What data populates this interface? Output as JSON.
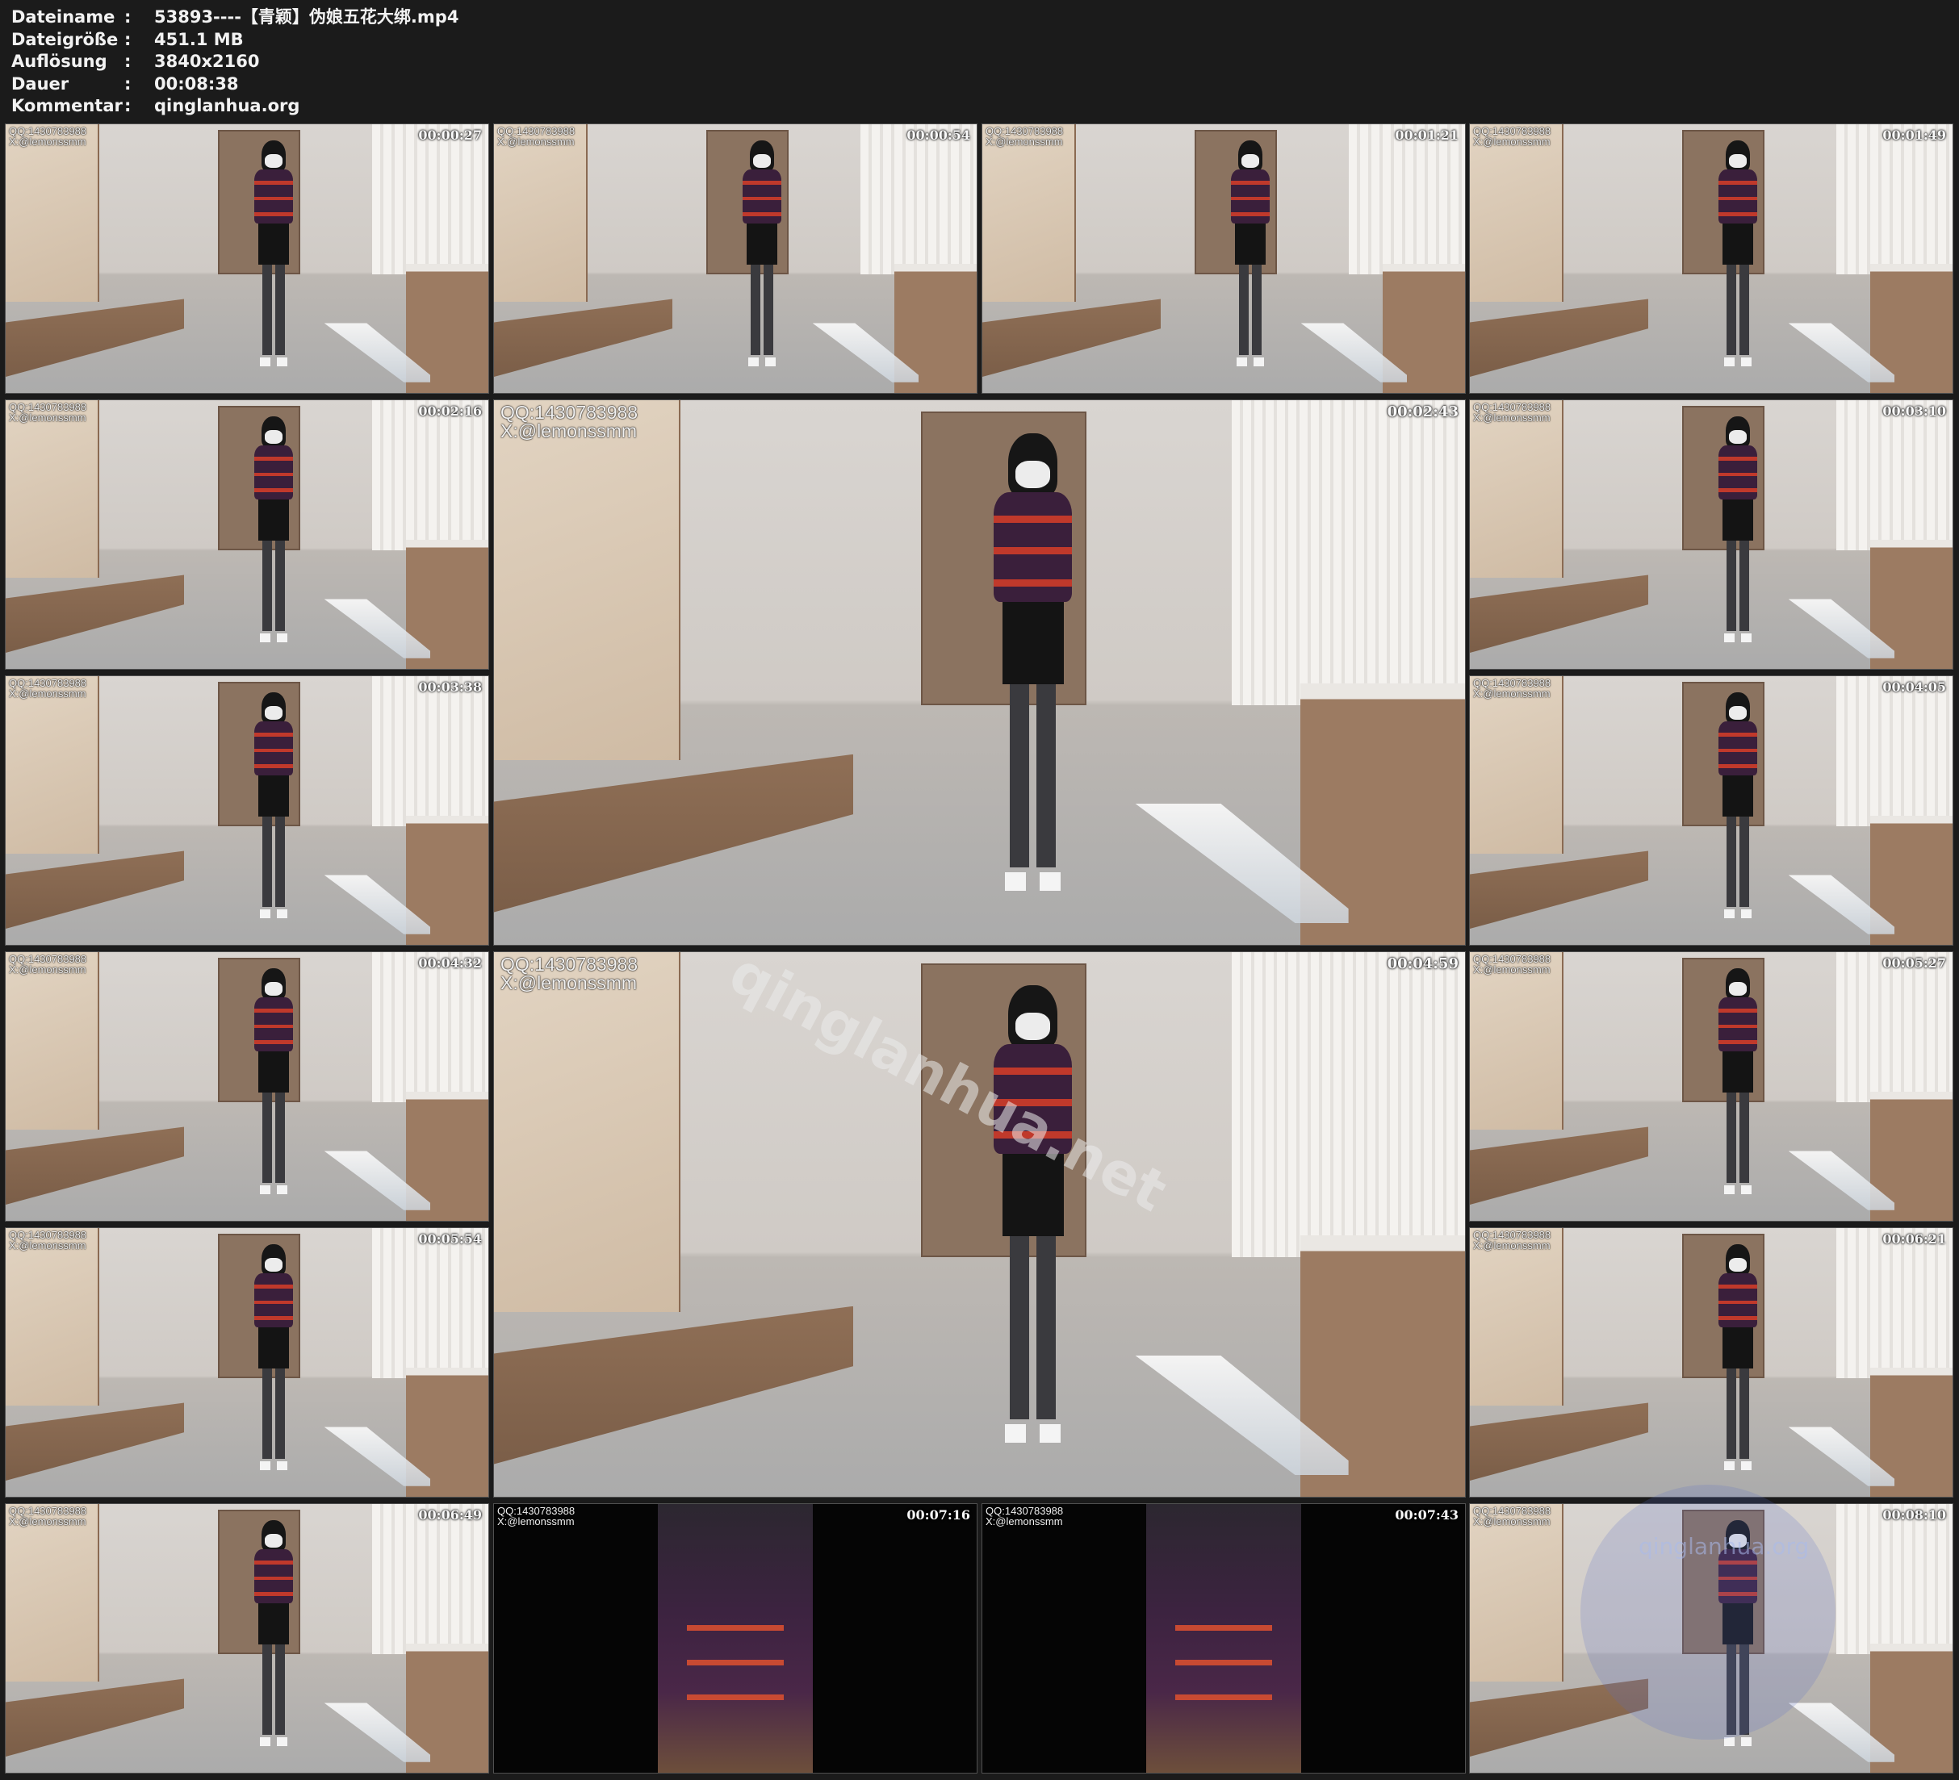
{
  "metadata": [
    {
      "key": "Dateiname",
      "value": "53893----【青颖】伪娘五花大绑.mp4"
    },
    {
      "key": "Dateigröße",
      "value": "451.1 MB"
    },
    {
      "key": "Auflösung",
      "value": "3840x2160"
    },
    {
      "key": "Dauer",
      "value": "00:08:38"
    },
    {
      "key": "Kommentar",
      "value": "qinglanhua.org"
    }
  ],
  "separator": ":",
  "watermark": {
    "line1": "QQ:1430783988",
    "line2": "X:@lemonssmm"
  },
  "frames": [
    {
      "id": "f1",
      "time": "00:00:27",
      "size": "small"
    },
    {
      "id": "f2",
      "time": "00:00:54",
      "size": "small"
    },
    {
      "id": "f3",
      "time": "00:01:21",
      "size": "small"
    },
    {
      "id": "f4",
      "time": "00:01:49",
      "size": "small"
    },
    {
      "id": "f5",
      "time": "00:02:16",
      "size": "small"
    },
    {
      "id": "f6",
      "time": "00:02:43",
      "size": "big"
    },
    {
      "id": "f7",
      "time": "00:03:10",
      "size": "small"
    },
    {
      "id": "f8",
      "time": "00:03:38",
      "size": "small"
    },
    {
      "id": "f9",
      "time": "00:04:05",
      "size": "small"
    },
    {
      "id": "f10",
      "time": "00:04:32",
      "size": "small"
    },
    {
      "id": "f11",
      "time": "00:04:59",
      "size": "big"
    },
    {
      "id": "f12",
      "time": "00:05:27",
      "size": "small"
    },
    {
      "id": "f13",
      "time": "00:05:54",
      "size": "small"
    },
    {
      "id": "f14",
      "time": "00:06:21",
      "size": "small"
    },
    {
      "id": "f15",
      "time": "00:06:49",
      "size": "small"
    },
    {
      "id": "f16",
      "time": "00:07:16",
      "size": "small",
      "dark": true
    },
    {
      "id": "f17",
      "time": "00:07:43",
      "size": "small",
      "dark": true
    },
    {
      "id": "f18",
      "time": "00:08:10",
      "size": "small"
    }
  ],
  "overlay_watermark": "qinglanhua.net",
  "corner_badge": "qinglanhua.org"
}
